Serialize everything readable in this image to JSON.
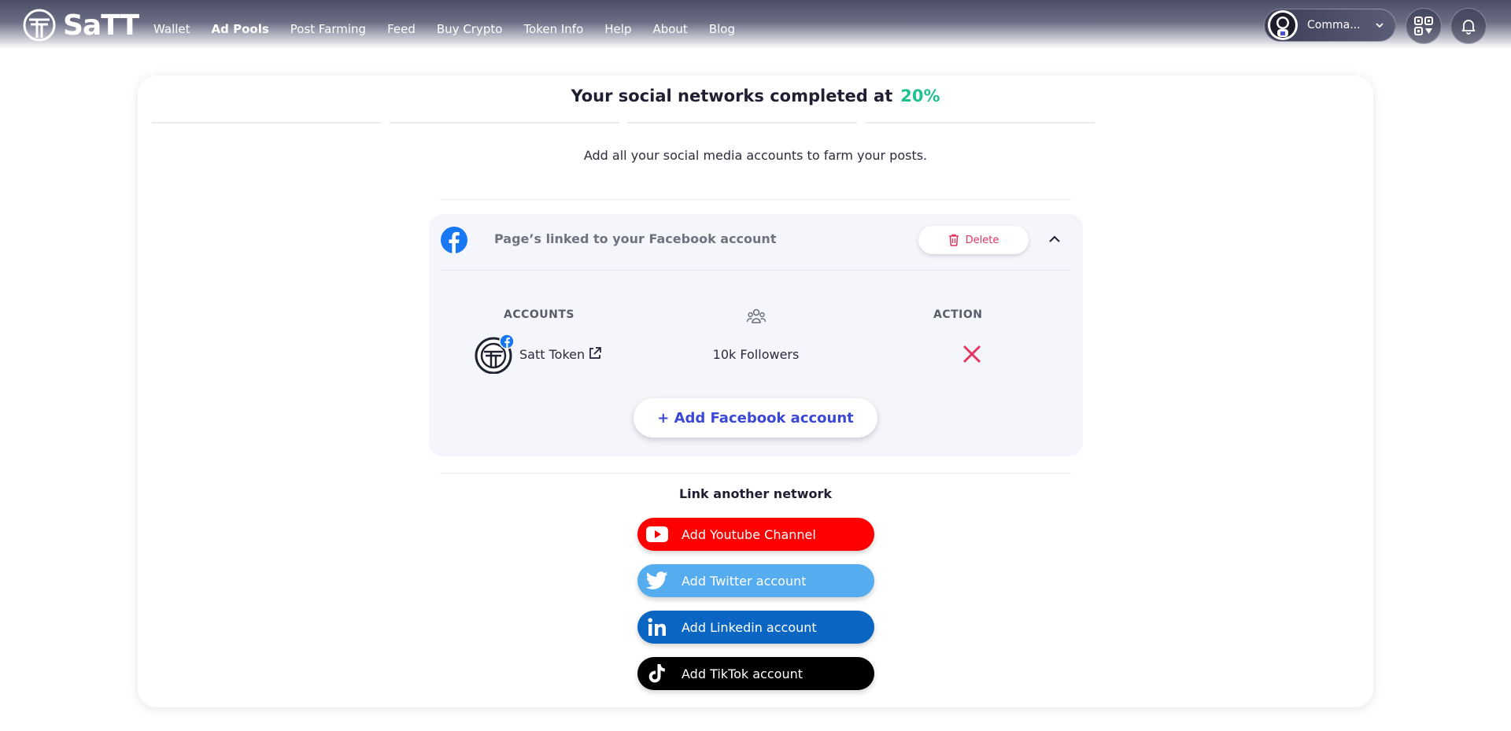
{
  "brand": {
    "name": "SaTT"
  },
  "nav": {
    "items": [
      {
        "label": "Wallet",
        "active": false
      },
      {
        "label": "Ad Pools",
        "active": true
      },
      {
        "label": "Post Farming",
        "active": false
      },
      {
        "label": "Feed",
        "active": false
      },
      {
        "label": "Buy Crypto",
        "active": false
      },
      {
        "label": "Token Info",
        "active": false
      },
      {
        "label": "Help",
        "active": false
      },
      {
        "label": "About",
        "active": false
      },
      {
        "label": "Blog",
        "active": false
      }
    ]
  },
  "user": {
    "name": "Comma..."
  },
  "header_icons": [
    "qr-code-icon",
    "bell-icon"
  ],
  "main": {
    "title": "Your social networks completed at",
    "completion": "20%",
    "subtitle": "Add all your social media accounts to farm your posts.",
    "facebook": {
      "heading": "Page’s linked to your Facebook account",
      "delete_label": "Delete",
      "columns": {
        "accounts": "ACCOUNTS",
        "followers_icon": "users-icon",
        "action": "ACTION"
      },
      "accounts": [
        {
          "name": "Satt Token",
          "followers": "10k Followers"
        }
      ],
      "add_label": "+ Add Facebook account"
    },
    "link_another": "Link another network",
    "networks": [
      {
        "label": "Add Youtube Channel",
        "icon": "youtube-icon",
        "color": "#ff0000"
      },
      {
        "label": "Add Twitter account",
        "icon": "twitter-icon",
        "color": "#55acee"
      },
      {
        "label": "Add Linkedin account",
        "icon": "linkedin-icon",
        "color": "#0a66c2"
      },
      {
        "label": "Add TikTok account",
        "icon": "tiktok-icon",
        "color": "#000000"
      }
    ]
  },
  "colors": {
    "accent_green": "#1fc28e",
    "delete_red": "#e2365e",
    "facebook_blue": "#1877f2",
    "link_blue": "#3b47d6"
  }
}
